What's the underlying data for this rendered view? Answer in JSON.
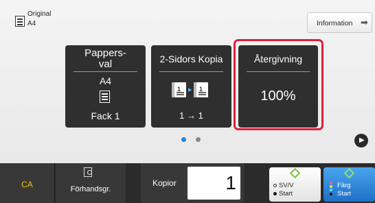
{
  "header": {
    "original_label": "Original",
    "original_value": "A4",
    "info_button": "Information"
  },
  "tiles": {
    "paper": {
      "title": "Pappers-\nval",
      "size": "A4",
      "tray": "Fack 1"
    },
    "duplex": {
      "title": "2-Sidors Kopia",
      "mode": "1 → 1",
      "sheet_left": "1",
      "sheet_right": "1"
    },
    "reproduction": {
      "title": "Återgivning",
      "value": "100%"
    }
  },
  "pager": {
    "pages": 2,
    "current": 1
  },
  "bottom": {
    "ca_label": "CA",
    "preview_label": "Förhandsgr.",
    "copies_label": "Kopior",
    "copies_value": "1",
    "bw_line1": "SV/V",
    "bw_line2": "Start",
    "color_line1": "Färg",
    "color_line2": "Start"
  },
  "colors": {
    "highlight": "#d9233a",
    "tile_bg": "#2f2f2f",
    "ca_text": "#f5c400",
    "start_green": "#7cbf3a",
    "color_button": "#2a83d6"
  },
  "icons": [
    "original-document-icon",
    "arrow-right-icon",
    "paper-tray-icon",
    "duplex-sheets-icon",
    "preview-magnifier-icon",
    "start-diamond-icon",
    "next-page-icon"
  ]
}
